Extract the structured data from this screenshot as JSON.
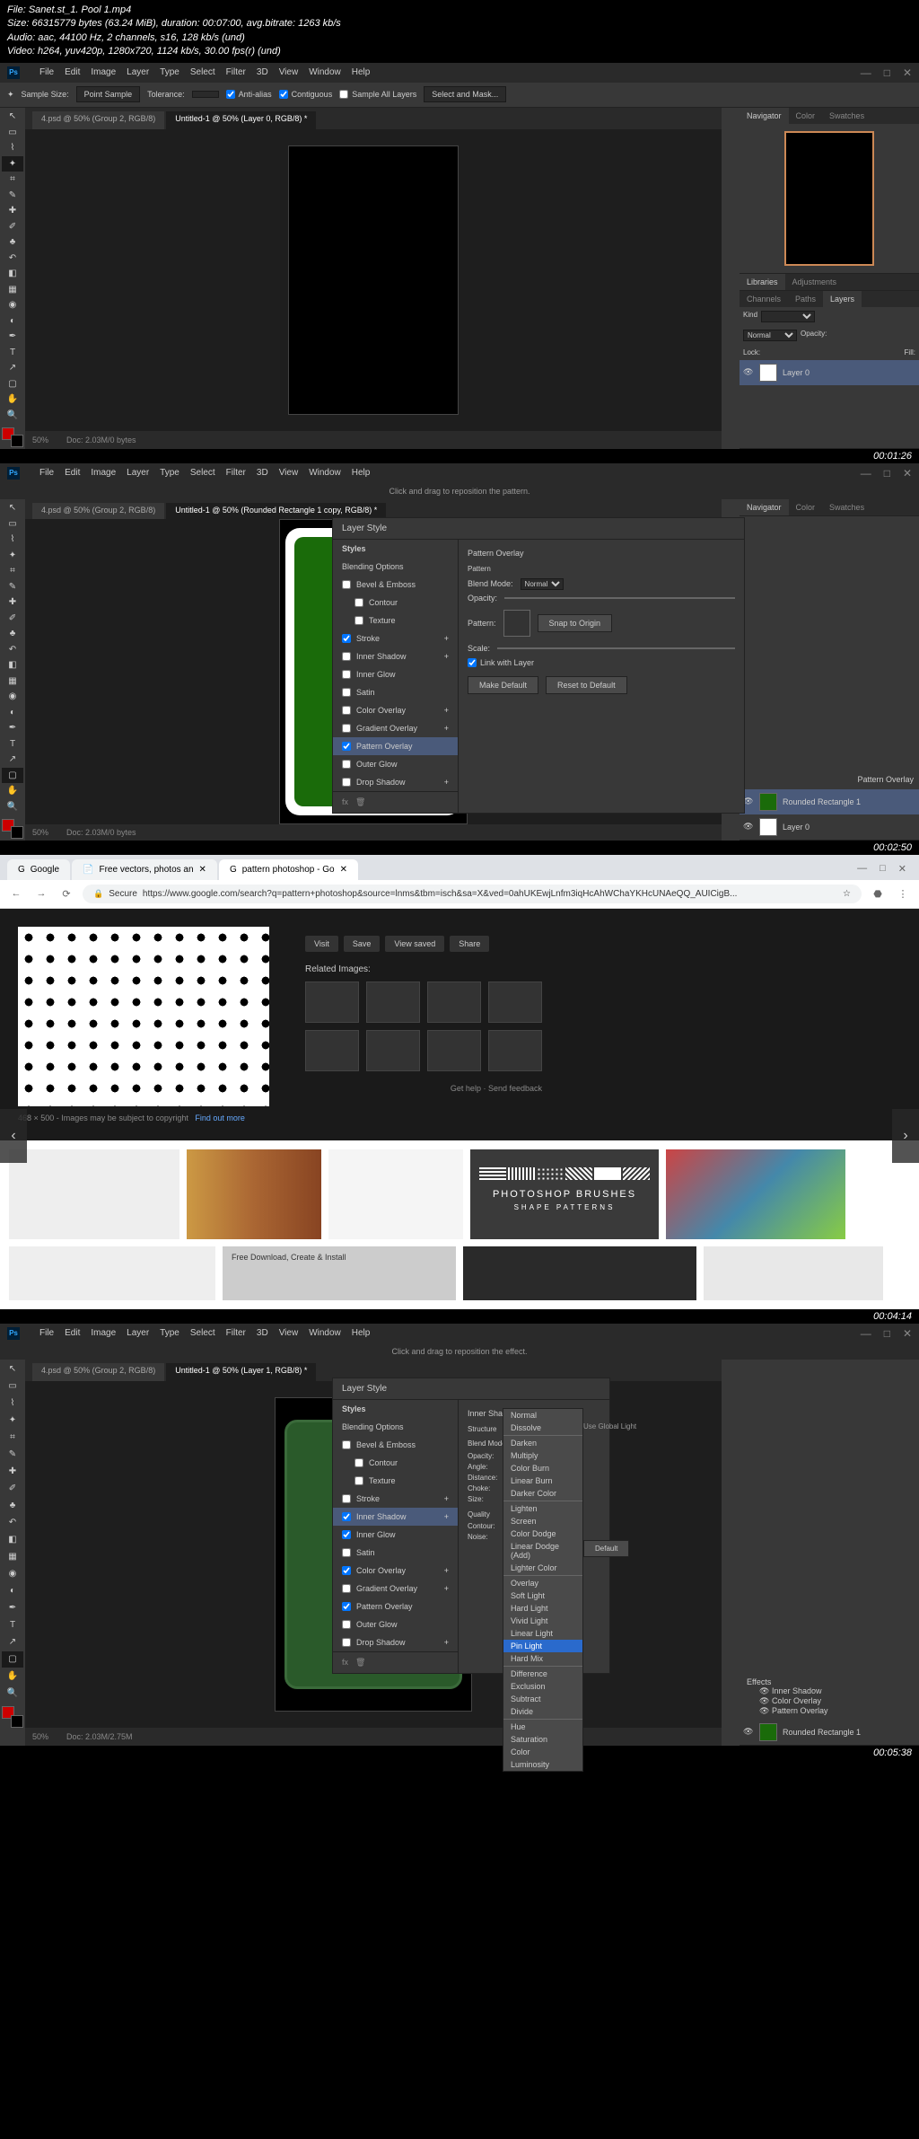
{
  "file_info": {
    "file": "File: Sanet.st_1. Pool 1.mp4",
    "size": "Size: 66315779 bytes (63.24 MiB), duration: 00:07:00, avg.bitrate: 1263 kb/s",
    "audio": "Audio: aac, 44100 Hz, 2 channels, s16, 128 kb/s (und)",
    "video": "Video: h264, yuv420p, 1280x720, 1124 kb/s, 30.00 fps(r) (und)"
  },
  "menus": [
    "File",
    "Edit",
    "Image",
    "Layer",
    "Type",
    "Select",
    "Filter",
    "3D",
    "View",
    "Window",
    "Help"
  ],
  "optbar1": {
    "sample_size": "Sample Size:",
    "sample_val": "Point Sample",
    "tolerance": "Tolerance:",
    "tol_val": "",
    "antialias": "Anti-alias",
    "contiguous": "Contiguous",
    "all_layers": "Sample All Layers",
    "select_mask": "Select and Mask..."
  },
  "tabs1": {
    "t1": "4.psd @ 50% (Group 2, RGB/8)",
    "t2": "Untitled-1 @ 50% (Layer 0, RGB/8) *"
  },
  "tabs2": {
    "t2": "Untitled-1 @ 50% (Rounded Rectangle 1 copy, RGB/8) *"
  },
  "tabs4": {
    "t2": "Untitled-1 @ 50% (Layer 1, RGB/8) *"
  },
  "panels": {
    "navigator": "Navigator",
    "color": "Color",
    "swatches": "Swatches",
    "libraries": "Libraries",
    "adjustments": "Adjustments",
    "channels": "Channels",
    "paths": "Paths",
    "layers": "Layers",
    "kind": "Kind"
  },
  "layers1": {
    "normal": "Normal",
    "opacity": "Opacity:",
    "lock": "Lock:",
    "fill": "Fill:",
    "layer0": "Layer 0"
  },
  "layers2": {
    "pattern_overlay": "Pattern Overlay",
    "rounded": "Rounded Rectangle 1",
    "layer0": "Layer 0",
    "effects": "Effects",
    "inner_shadow": "Inner Shadow",
    "color_overlay": "Color Overlay",
    "rounded2": "Rounded Rectangle 1"
  },
  "status": {
    "zoom": "50%",
    "doc": "Doc: 2.03M/0 bytes",
    "doc2": "Doc: 2.03M/2.75M"
  },
  "msg2": "Click and drag to reposition the pattern.",
  "msg4": "Click and drag to reposition the effect.",
  "layer_style": {
    "title": "Layer Style",
    "styles": "Styles",
    "blending": "Blending Options",
    "bevel": "Bevel & Emboss",
    "contour": "Contour",
    "texture": "Texture",
    "stroke": "Stroke",
    "inner_shadow": "Inner Shadow",
    "inner_glow": "Inner Glow",
    "satin": "Satin",
    "color_overlay": "Color Overlay",
    "gradient": "Gradient Overlay",
    "pattern": "Pattern Overlay",
    "outer_glow": "Outer Glow",
    "drop_shadow": "Drop Shadow",
    "structure": "Structure",
    "blend_mode": "Blend Mode:",
    "multiply": "Multiply",
    "opacity": "Opacity:",
    "angle": "Angle:",
    "global": "Use Global Light",
    "distance": "Distance:",
    "choke": "Choke:",
    "size_l": "Size:",
    "quality": "Quality",
    "contour_l": "Contour:",
    "noise": "Noise:",
    "default_btn": "Make Default",
    "reset_btn": "Reset to Default",
    "snap": "Snap to Origin",
    "link": "Link with Layer",
    "scale": "Scale:",
    "sec_po": "Pattern Overlay",
    "sec_po_sub": "Pattern",
    "sec_is": "Inner Shadow"
  },
  "blend_modes": [
    "Normal",
    "Dissolve",
    "Darken",
    "Multiply",
    "Color Burn",
    "Linear Burn",
    "Darker Color",
    "Lighten",
    "Screen",
    "Color Dodge",
    "Linear Dodge (Add)",
    "Lighter Color",
    "Overlay",
    "Soft Light",
    "Hard Light",
    "Vivid Light",
    "Linear Light",
    "Pin Light",
    "Hard Mix",
    "Difference",
    "Exclusion",
    "Subtract",
    "Divide",
    "Hue",
    "Saturation",
    "Color",
    "Luminosity"
  ],
  "timestamps": {
    "t1": "00:01:26",
    "t2": "00:02:50",
    "t3": "00:04:14",
    "t4": "00:05:38"
  },
  "browser": {
    "tab1": "Google",
    "tab2": "Free vectors, photos an",
    "tab3": "pattern photoshop - Go",
    "secure": "Secure",
    "url": "https://www.google.com/search?q=pattern+photoshop&source=lnms&tbm=isch&sa=X&ved=0ahUKEwjLnfm3iqHcAhWChaYKHcUNAeQQ_AUICigB...",
    "related": "Related Images:",
    "visit": "Visit",
    "save": "Save",
    "view_saved": "View saved",
    "share": "Share",
    "dims": "468 × 500 - Images may be subject to copyright",
    "find": "Find out more",
    "help": "Get help · Send feedback",
    "brushes": "PHOTOSHOP BRUSHES",
    "shapes": "SHAPE PATTERNS",
    "free_dl": "Free Download, Create & Install"
  }
}
